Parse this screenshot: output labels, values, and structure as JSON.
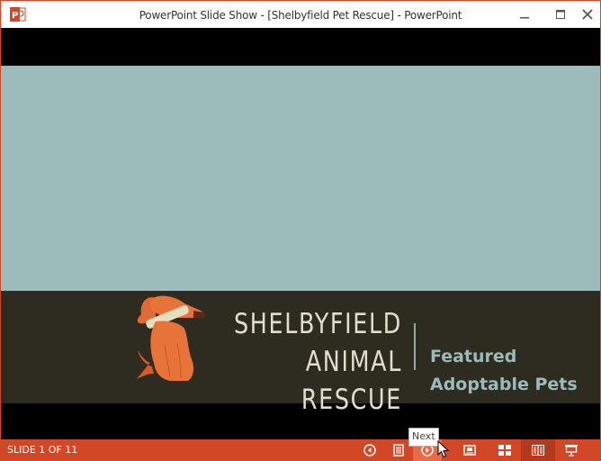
{
  "window": {
    "title": "PowerPoint Slide Show - [Shelbyfield Pet Rescue] - PowerPoint",
    "app_icon": "powerpoint-icon",
    "controls": [
      "minimize-icon",
      "maximize-icon",
      "close-icon"
    ],
    "accent_color": "#d24726"
  },
  "slide": {
    "org_name_line1": "SHELBYFIELD",
    "org_name_line2": "ANIMAL RESCUE",
    "tagline_line1": "Featured",
    "tagline_line2": "Adoptable Pets",
    "logo": "dog-with-bone-logo",
    "colors": {
      "top": "#9bbcba",
      "band": "#2e2b21",
      "title_text": "#e3decb",
      "tagline_text": "#9bbcba"
    }
  },
  "statusbar": {
    "slide_count": "SLIDE 1 OF 11",
    "buttons": [
      {
        "name": "previous-button",
        "icon": "previous-icon"
      },
      {
        "name": "slide-list-button",
        "icon": "list-icon"
      },
      {
        "name": "next-button",
        "icon": "next-icon"
      },
      {
        "name": "normal-view-button",
        "icon": "normal-view-icon"
      },
      {
        "name": "slide-sorter-button",
        "icon": "grid-icon"
      },
      {
        "name": "reading-view-button",
        "icon": "book-icon"
      },
      {
        "name": "slide-show-button",
        "icon": "presenter-icon"
      }
    ],
    "tooltip": "Next"
  }
}
